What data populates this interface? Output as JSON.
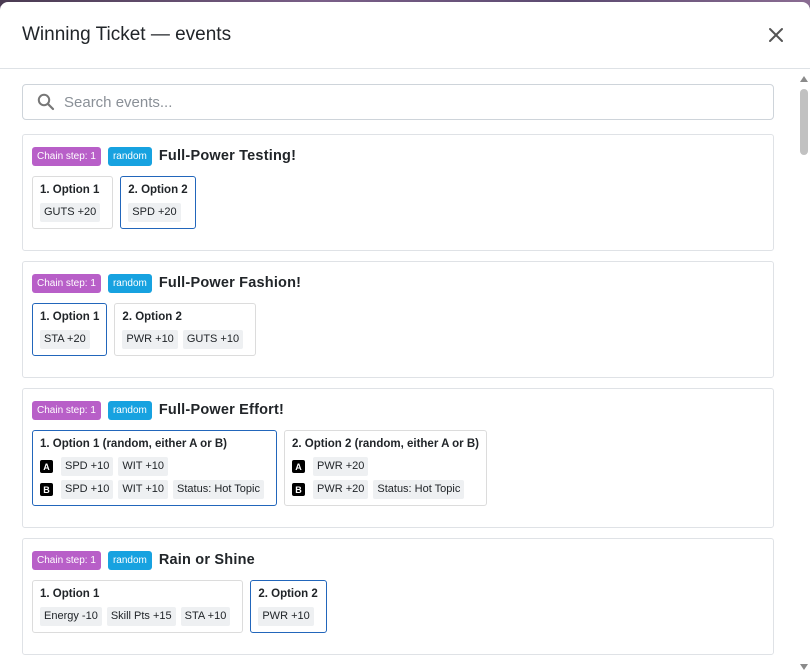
{
  "modal": {
    "title": "Winning Ticket — events",
    "close_icon": "close-icon"
  },
  "search": {
    "placeholder": "Search events...",
    "value": ""
  },
  "colors": {
    "chain_badge": "#b85fc8",
    "random_badge": "#17a2e0",
    "selected_border": "#2266bb"
  },
  "events": [
    {
      "chain": "Chain step: 1",
      "type": "random",
      "title": "Full-Power Testing!",
      "options": [
        {
          "label": "1. Option 1",
          "selected": false,
          "effects": [
            "GUTS +20"
          ]
        },
        {
          "label": "2. Option 2",
          "selected": true,
          "effects": [
            "SPD +20"
          ]
        }
      ]
    },
    {
      "chain": "Chain step: 1",
      "type": "random",
      "title": "Full-Power Fashion!",
      "options": [
        {
          "label": "1. Option 1",
          "selected": true,
          "effects": [
            "STA +20"
          ]
        },
        {
          "label": "2. Option 2",
          "selected": false,
          "effects": [
            "PWR +10",
            "GUTS +10"
          ]
        }
      ]
    },
    {
      "chain": "Chain step: 1",
      "type": "random",
      "title": "Full-Power Effort!",
      "options": [
        {
          "label": "1. Option 1 (random, either A or B)",
          "selected": true,
          "rows": [
            {
              "letter": "A",
              "effects": [
                "SPD +10",
                "WIT +10"
              ]
            },
            {
              "letter": "B",
              "effects": [
                "SPD +10",
                "WIT +10",
                "Status: Hot Topic"
              ]
            }
          ]
        },
        {
          "label": "2. Option 2 (random, either A or B)",
          "selected": false,
          "rows": [
            {
              "letter": "A",
              "effects": [
                "PWR +20"
              ]
            },
            {
              "letter": "B",
              "effects": [
                "PWR +20",
                "Status: Hot Topic"
              ]
            }
          ]
        }
      ]
    },
    {
      "chain": "Chain step: 1",
      "type": "random",
      "title": "Rain or Shine",
      "options": [
        {
          "label": "1. Option 1",
          "selected": false,
          "effects": [
            "Energy -10",
            "Skill Pts +15",
            "STA +10"
          ]
        },
        {
          "label": "2. Option 2",
          "selected": true,
          "effects": [
            "PWR +10"
          ]
        }
      ]
    }
  ]
}
